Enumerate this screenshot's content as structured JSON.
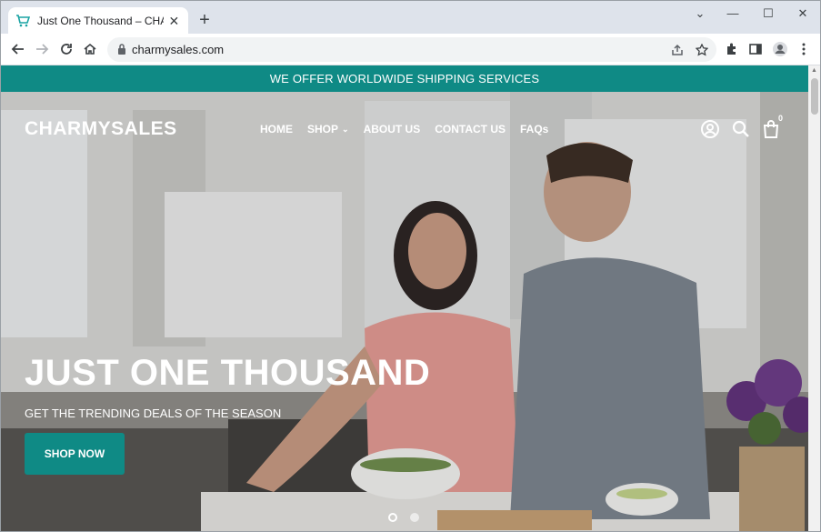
{
  "browser": {
    "tab_title": "Just One Thousand – CHARMYSALES",
    "tab_close": "✕",
    "new_tab": "+",
    "url": "charmysales.com",
    "window_controls": [
      "⌄",
      "—",
      "☐",
      "✕"
    ],
    "toolbar_icons": [
      "back-icon",
      "forward-icon",
      "reload-icon",
      "home-icon",
      "share-icon",
      "star-icon",
      "extensions-icon",
      "sidepanel-icon",
      "profile-icon",
      "menu-icon"
    ]
  },
  "site": {
    "announcement": "WE OFFER WORLDWIDE SHIPPING SERVICES",
    "logo": "CHARMYSALES",
    "nav": {
      "home": "HOME",
      "shop": "SHOP",
      "about": "ABOUT US",
      "contact": "CONTACT US",
      "faqs": "FAQs"
    },
    "cart_count": "0",
    "colors": {
      "brand": "#0f8a85"
    }
  },
  "hero": {
    "title": "JUST ONE THOUSAND",
    "subtitle": "GET THE TRENDING DEALS OF THE SEASON",
    "button": "SHOP NOW",
    "slide_count": 2,
    "active_slide": 1
  }
}
